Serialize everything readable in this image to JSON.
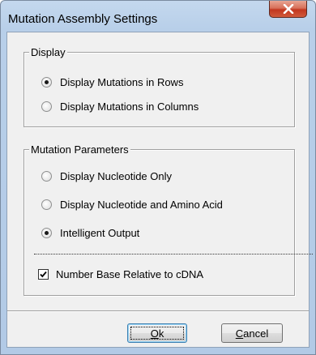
{
  "window": {
    "title": "Mutation Assembly Settings",
    "close_icon": "close-x-icon"
  },
  "display_group": {
    "label": "Display",
    "options": [
      {
        "label": "Display Mutations in Rows",
        "checked": true
      },
      {
        "label": "Display Mutations in Columns",
        "checked": false
      }
    ]
  },
  "mutation_group": {
    "label": "Mutation Parameters",
    "options": [
      {
        "label": "Display Nucleotide Only",
        "checked": false
      },
      {
        "label": "Display Nucleotide and Amino Acid",
        "checked": false
      },
      {
        "label": "Intelligent Output",
        "checked": true
      }
    ],
    "checkbox": {
      "label": "Number Base Relative to cDNA",
      "checked": true
    }
  },
  "buttons": {
    "ok": {
      "mnemonic": "O",
      "rest": "k"
    },
    "cancel": {
      "mnemonic": "C",
      "rest": "ancel"
    }
  }
}
